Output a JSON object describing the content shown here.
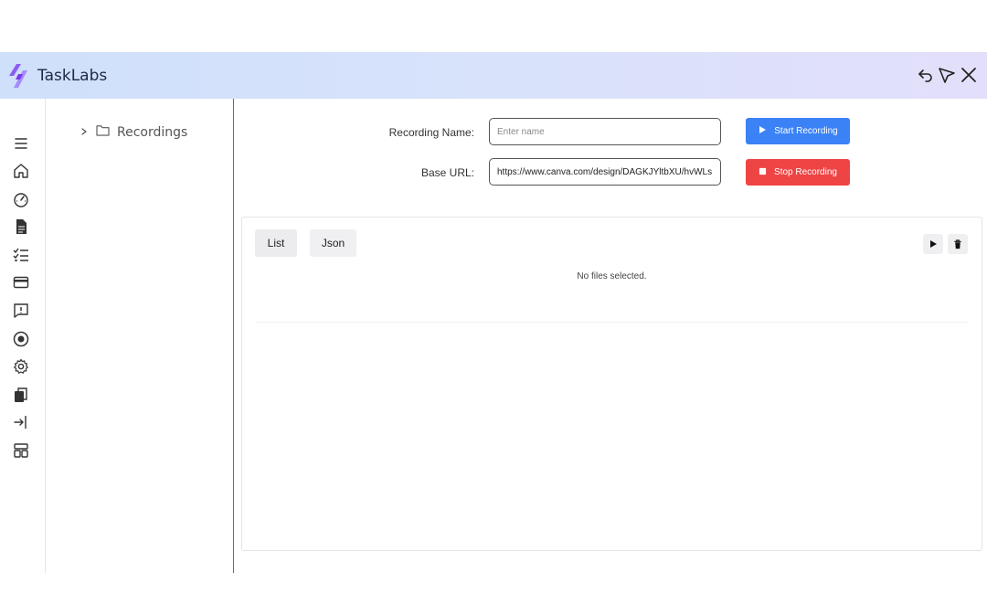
{
  "app": {
    "title": "TaskLabs"
  },
  "titlebar": {
    "icons": [
      "undo-icon",
      "cursor-icon",
      "close-icon"
    ]
  },
  "sidebar": {
    "icons": [
      "menu-icon",
      "home-icon",
      "dashboard-gauge-icon",
      "document-icon",
      "checklist-icon",
      "card-icon",
      "feedback-icon",
      "record-icon",
      "settings-icon",
      "copy-icon",
      "login-icon",
      "layout-icon"
    ]
  },
  "tree": {
    "items": [
      {
        "label": "Recordings",
        "expanded": false
      }
    ]
  },
  "form": {
    "recording_name_label": "Recording Name:",
    "recording_name_placeholder": "Enter name",
    "recording_name_value": "",
    "base_url_label": "Base URL:",
    "base_url_value": "https://www.canva.com/design/DAGKJYltbXU/hvWLs.",
    "start_button": "Start Recording",
    "stop_button": "Stop Recording"
  },
  "panel": {
    "tabs": [
      "List",
      "Json"
    ],
    "empty_message": "No files selected."
  },
  "colors": {
    "accent": "#3b82f6",
    "danger": "#ef4444",
    "sidebar_divider": "#5a6a9a"
  }
}
